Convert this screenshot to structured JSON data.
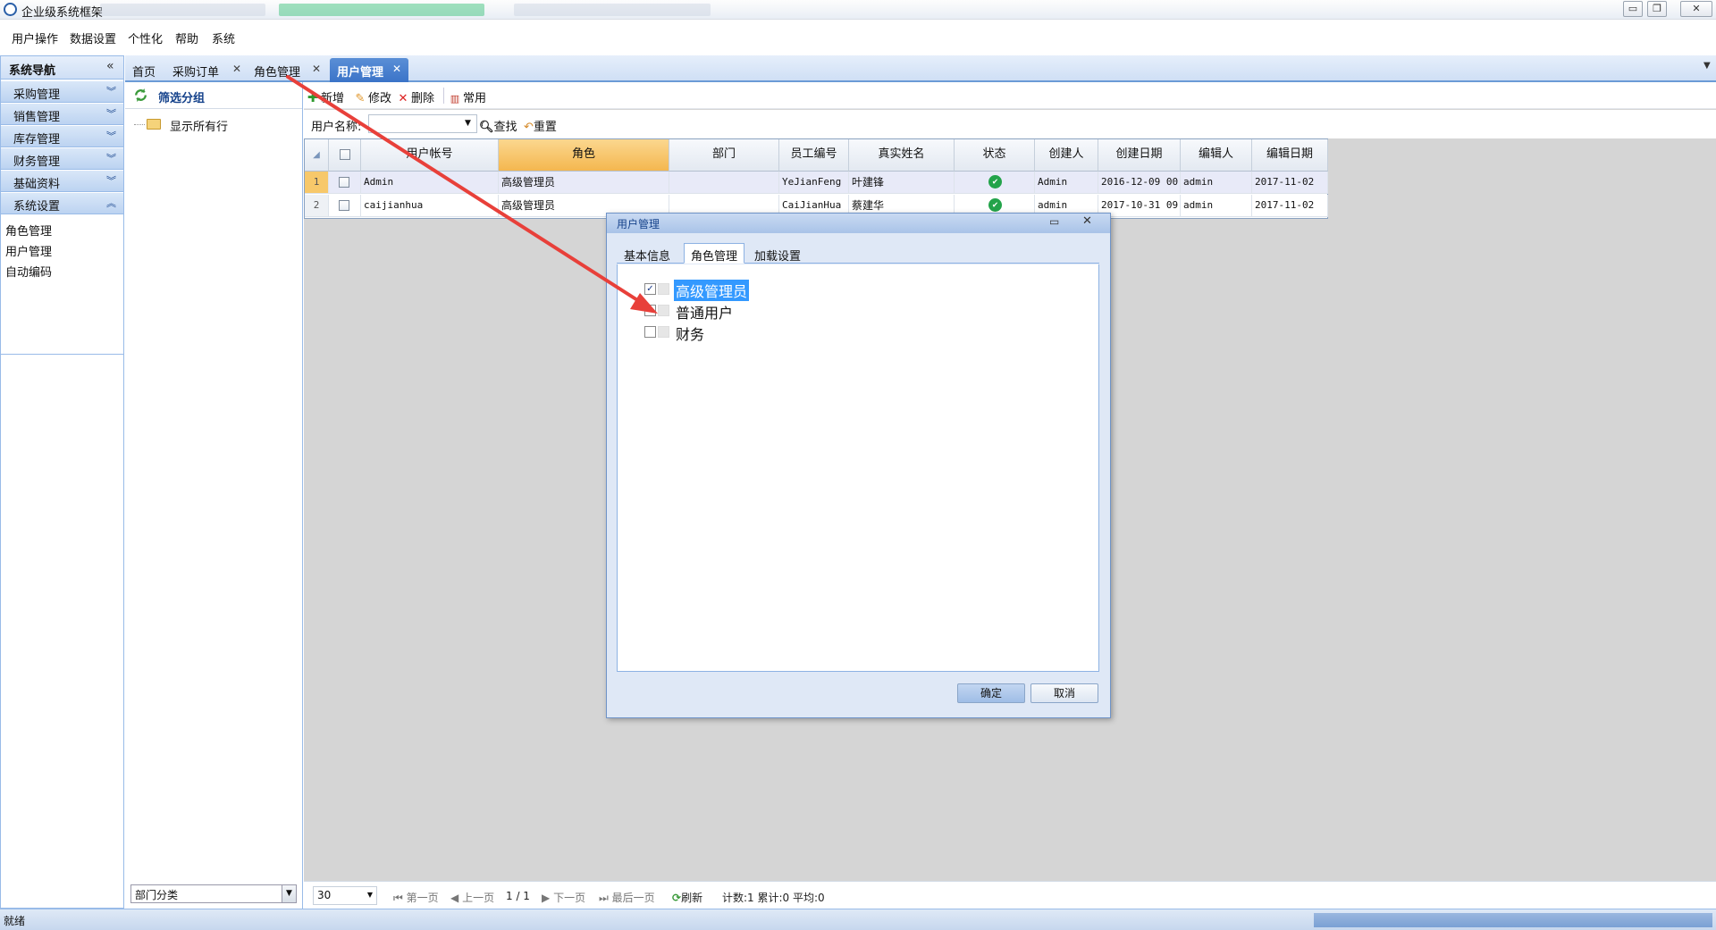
{
  "window": {
    "title": "企业级系统框架"
  },
  "menu": [
    "用户操作",
    "数据设置",
    "个性化",
    "帮助",
    "系统"
  ],
  "nav": {
    "title": "系统导航",
    "groups": [
      {
        "label": "采购管理"
      },
      {
        "label": "销售管理"
      },
      {
        "label": "库存管理"
      },
      {
        "label": "财务管理"
      },
      {
        "label": "基础资料"
      },
      {
        "label": "系统设置"
      }
    ],
    "links": [
      "角色管理",
      "用户管理",
      "自动编码"
    ]
  },
  "tabs": [
    {
      "label": "首页"
    },
    {
      "label": "采购订单"
    },
    {
      "label": "角色管理"
    },
    {
      "label": "用户管理"
    }
  ],
  "group_panel": {
    "title": "筛选分组",
    "tree_item": "显示所有行",
    "dept_select": "部门分类"
  },
  "toolbar": {
    "add": "新增",
    "edit": "修改",
    "delete": "删除",
    "common": "常用"
  },
  "search": {
    "label": "用户名称:",
    "find": "查找",
    "reset": "重置"
  },
  "grid": {
    "columns": [
      "用户帐号",
      "角色",
      "部门",
      "员工编号",
      "真实姓名",
      "状态",
      "创建人",
      "创建日期",
      "编辑人",
      "编辑日期"
    ],
    "rows": [
      {
        "no": "1",
        "account": "Admin",
        "role": "高级管理员",
        "dept": "",
        "emp_no": "YeJianFeng",
        "name": "叶建锋",
        "creator": "Admin",
        "created": "2016-12-09 00",
        "editor": "admin",
        "edited": "2017-11-02"
      },
      {
        "no": "2",
        "account": "caijianhua",
        "role": "高级管理员",
        "dept": "",
        "emp_no": "CaiJianHua",
        "name": "蔡建华",
        "creator": "admin",
        "created": "2017-10-31 09",
        "editor": "admin",
        "edited": "2017-11-02"
      }
    ]
  },
  "pager": {
    "page_size": "30",
    "first": "第一页",
    "prev": "上一页",
    "page_info": "1 / 1",
    "next": "下一页",
    "last": "最后一页",
    "refresh": "刷新",
    "stats": "计数:1 累计:0 平均:0"
  },
  "status": {
    "text": "就绪"
  },
  "dialog": {
    "title": "用户管理",
    "tabs": [
      "基本信息",
      "角色管理",
      "加载设置"
    ],
    "roles": [
      {
        "label": "高级管理员",
        "checked": true
      },
      {
        "label": "普通用户",
        "checked": false
      },
      {
        "label": "财务",
        "checked": false
      }
    ],
    "ok": "确定",
    "cancel": "取消"
  },
  "colors": {
    "accent": "#3b74c8",
    "header_selected": "#f4b74f",
    "annotation_arrow": "#e8403a"
  }
}
